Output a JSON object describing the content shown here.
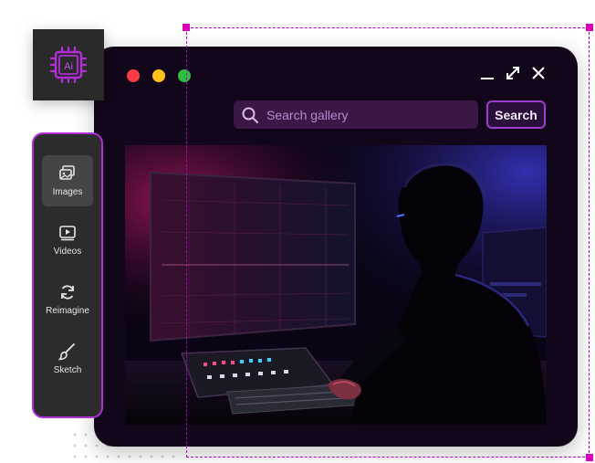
{
  "app": {
    "logo_text": "Ai"
  },
  "window": {
    "controls": [
      "minimize-icon",
      "expand-icon",
      "close-icon"
    ],
    "traffic_lights": [
      "#ff3b47",
      "#ffc21a",
      "#2fbf3f"
    ]
  },
  "search": {
    "placeholder": "Search gallery",
    "button_label": "Search"
  },
  "tools": [
    {
      "label": "Images",
      "icon": "images-icon",
      "active": true
    },
    {
      "label": "Videos",
      "icon": "video-icon",
      "active": false
    },
    {
      "label": "Reimagine",
      "icon": "refresh-icon",
      "active": false
    },
    {
      "label": "Sketch",
      "icon": "brush-icon",
      "active": false
    }
  ],
  "colors": {
    "accent": "#b12dd6",
    "window_bg": "#12071a",
    "search_bg": "#3a1747",
    "selection": "#d600b8"
  }
}
